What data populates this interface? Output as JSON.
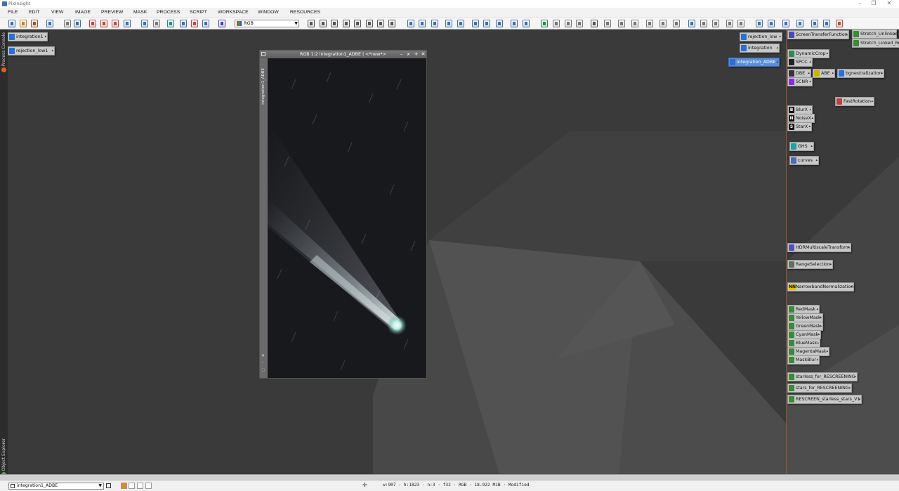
{
  "app": {
    "title": "PixInsight"
  },
  "menu": [
    "FILE",
    "EDIT",
    "VIEW",
    "IMAGE",
    "PREVIEW",
    "MASK",
    "PROCESS",
    "SCRIPT",
    "WORKSPACE",
    "WINDOW",
    "RESOURCES"
  ],
  "toolbar": {
    "color_mode": "RGB"
  },
  "left_strip": {
    "top_label": "Process Console",
    "bottom_label": "Object Explorer"
  },
  "image_icons": [
    {
      "label": "integration1",
      "color": "#2a6fd6"
    },
    {
      "label": "rejection_low1",
      "color": "#2a6fd6"
    },
    {
      "label": "rejection_low",
      "color": "#2a6fd6"
    },
    {
      "label": "integration",
      "color": "#2a6fd6"
    },
    {
      "label": "integration_ADBE",
      "color": "#2a6fd6"
    }
  ],
  "process_icons": [
    {
      "label": "ScreenTransferFunction",
      "color": "#4a4ab0"
    },
    {
      "label": "Stretch_Unlinked",
      "color": "#3a8a3a"
    },
    {
      "label": "Stretch_Linked_RGB",
      "color": "#3a8a3a"
    },
    {
      "label": "DynamicCrop",
      "color": "#2e8b57"
    },
    {
      "label": "SPCC",
      "color": "#222"
    },
    {
      "label": "DBE",
      "color": "#334"
    },
    {
      "label": "ABE",
      "color": "#c8b400"
    },
    {
      "label": "bgneutralization",
      "color": "#2a6fd6"
    },
    {
      "label": "SCNR",
      "color": "#8a2be2"
    },
    {
      "label": "FastRotation",
      "color": "#c04040"
    },
    {
      "label": "BlurX",
      "color": "#111",
      "glyph": "B"
    },
    {
      "label": "NoiseX",
      "color": "#111",
      "glyph": "N"
    },
    {
      "label": "StarX",
      "color": "#111",
      "glyph": "S"
    },
    {
      "label": "GHS",
      "color": "#20a0a0"
    },
    {
      "label": "curves",
      "color": "#4a6fb0"
    },
    {
      "label": "HDRMultiscaleTransform",
      "color": "#5050c0"
    },
    {
      "label": "RangeSelection",
      "color": "#607060"
    },
    {
      "label": "NarrowbandNormalization",
      "color": "#e0c000",
      "glyph": "NN"
    },
    {
      "label": "RedMask",
      "color": "#3a8a3a"
    },
    {
      "label": "YellowMask",
      "color": "#3a8a3a"
    },
    {
      "label": "GreenMask",
      "color": "#3a8a3a"
    },
    {
      "label": "CyanMask",
      "color": "#3a8a3a"
    },
    {
      "label": "BlueMask",
      "color": "#3a8a3a"
    },
    {
      "label": "MagentaMask",
      "color": "#3a8a3a"
    },
    {
      "label": "MaskBlur",
      "color": "#3a8a3a"
    },
    {
      "label": "starless_for_RESCREENING",
      "color": "#3a8a3a"
    },
    {
      "label": "stars_for_RESCREENING",
      "color": "#3a8a3a"
    },
    {
      "label": "RESCREEN_starless_stars_V1",
      "color": "#3a8a3a"
    }
  ],
  "image_window": {
    "title": "RGB 1:2 integration1_ADBE | <*new*>",
    "side_label": "integration1_ADBE"
  },
  "status": {
    "view": "integration1_ADBE",
    "info": "w:907  ·  h:1823  ·  n:3  ·  f32  ·  RGB  ·  18.922 MiB  ·  Modified"
  }
}
